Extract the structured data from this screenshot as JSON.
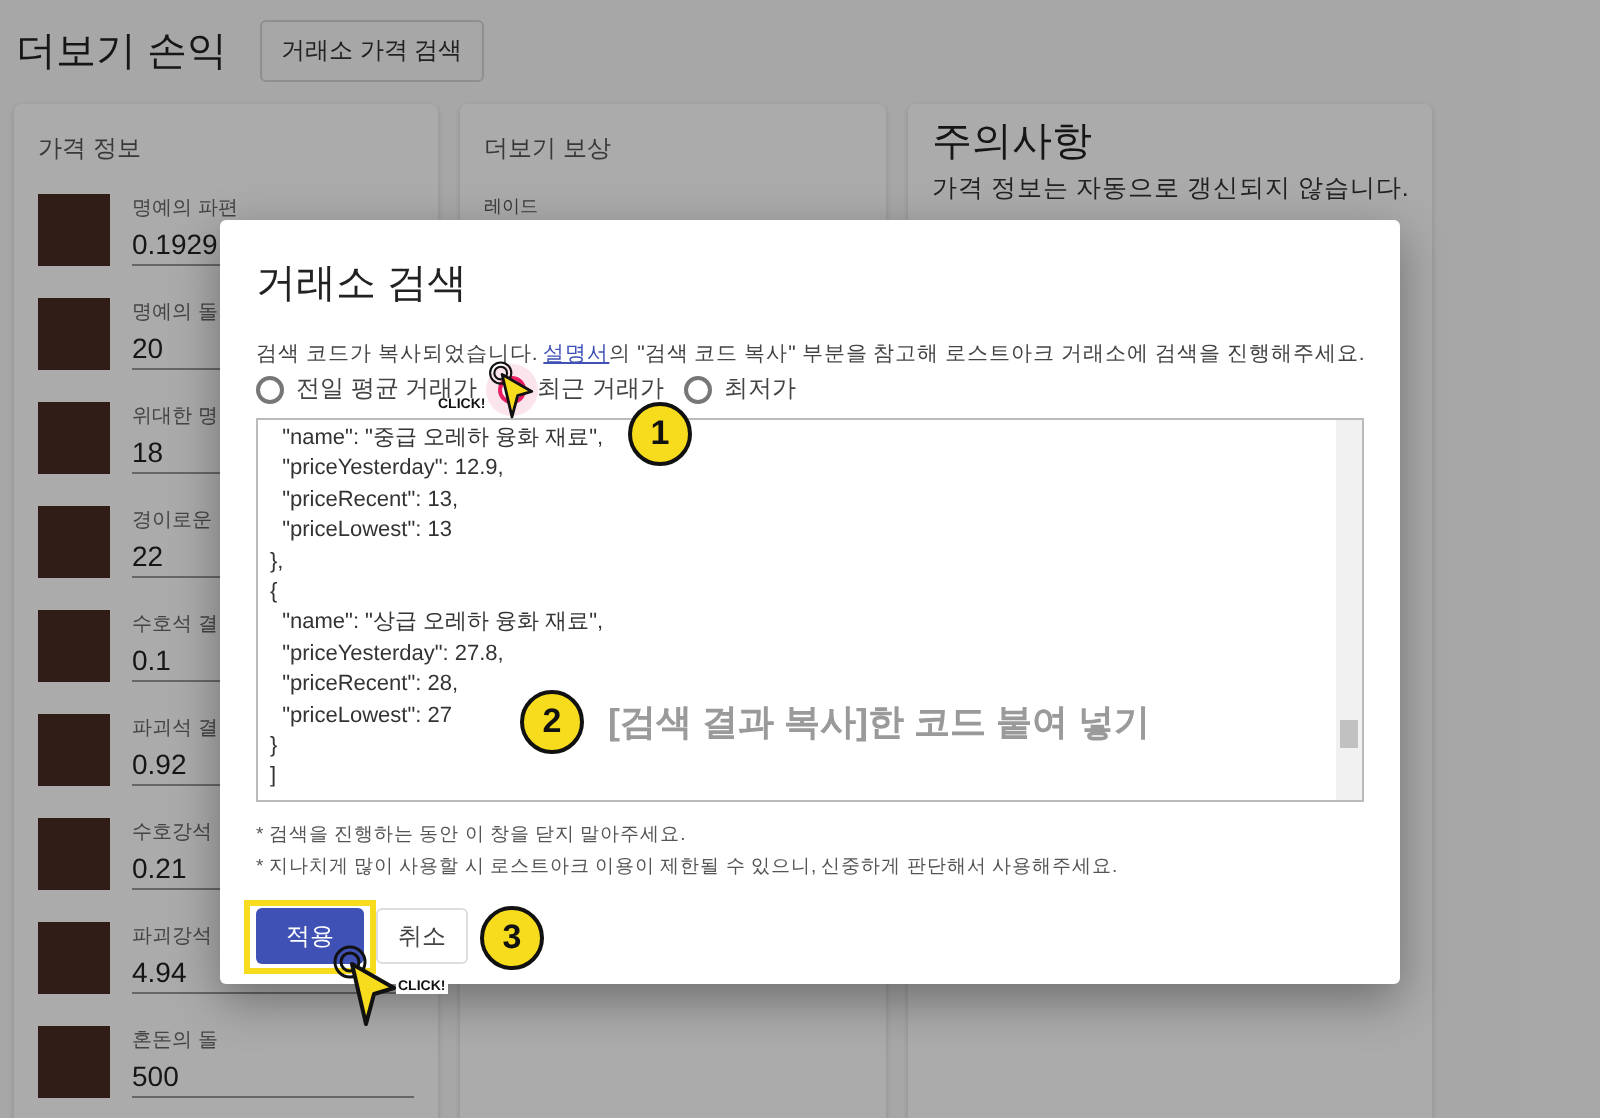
{
  "page": {
    "title": "더보기 손익",
    "search_button": "거래소 가격 검색"
  },
  "price_info": {
    "title": "가격 정보",
    "items": [
      {
        "label": "명예의 파편",
        "value": "0.1929"
      },
      {
        "label": "명예의 돌",
        "value": "20"
      },
      {
        "label": "위대한 명",
        "value": "18"
      },
      {
        "label": "경이로운",
        "value": "22"
      },
      {
        "label": "수호석 결",
        "value": "0.1"
      },
      {
        "label": "파괴석 결",
        "value": "0.92"
      },
      {
        "label": "수호강석",
        "value": "0.21"
      },
      {
        "label": "파괴강석",
        "value": "4.94"
      },
      {
        "label": "혼돈의 돌",
        "value": "500"
      }
    ]
  },
  "rewards": {
    "title": "더보기 보상",
    "subtitle": "레이드"
  },
  "notice": {
    "title": "주의사항",
    "text": "가격 정보는 자동으로 갱신되지 않습니다."
  },
  "dialog": {
    "title": "거래소 검색",
    "description_before": "검색 코드가 복사되었습니다. ",
    "link": "설명서",
    "description_after": "의 \"검색 코드 복사\" 부분을 참고해 로스트아크 거래소에 검색을 진행해주세요.",
    "options": [
      {
        "label": "전일 평균 거래가",
        "selected": false
      },
      {
        "label": "최근 거래가",
        "selected": true
      },
      {
        "label": "최저가",
        "selected": false
      }
    ],
    "code_lines": [
      "  \"name\": \"중급 오레하 융화 재료\",",
      "  \"priceYesterday\": 12.9,",
      "  \"priceRecent\": 13,",
      "  \"priceLowest\": 13",
      "},",
      "{",
      "  \"name\": \"상급 오레하 융화 재료\",",
      "  \"priceYesterday\": 27.8,",
      "  \"priceRecent\": 28,",
      "  \"priceLowest\": 27",
      "}",
      "]"
    ],
    "notes": [
      "* 검색을 진행하는 동안 이 창을 닫지 말아주세요.",
      "* 지나치게 많이 사용할 시 로스트아크 이용이 제한될 수 있으니, 신중하게 판단해서 사용해주세요."
    ],
    "buttons": [
      {
        "label": "적용",
        "kind": "primary"
      },
      {
        "label": "취소",
        "kind": "secondary"
      }
    ]
  },
  "annotations": {
    "steps": [
      "1",
      "2",
      "3"
    ],
    "click_labels": [
      "CLICK!",
      "CLICK!"
    ],
    "caption": "[검색 결과 복사]한 코드 붙여 넣기"
  }
}
